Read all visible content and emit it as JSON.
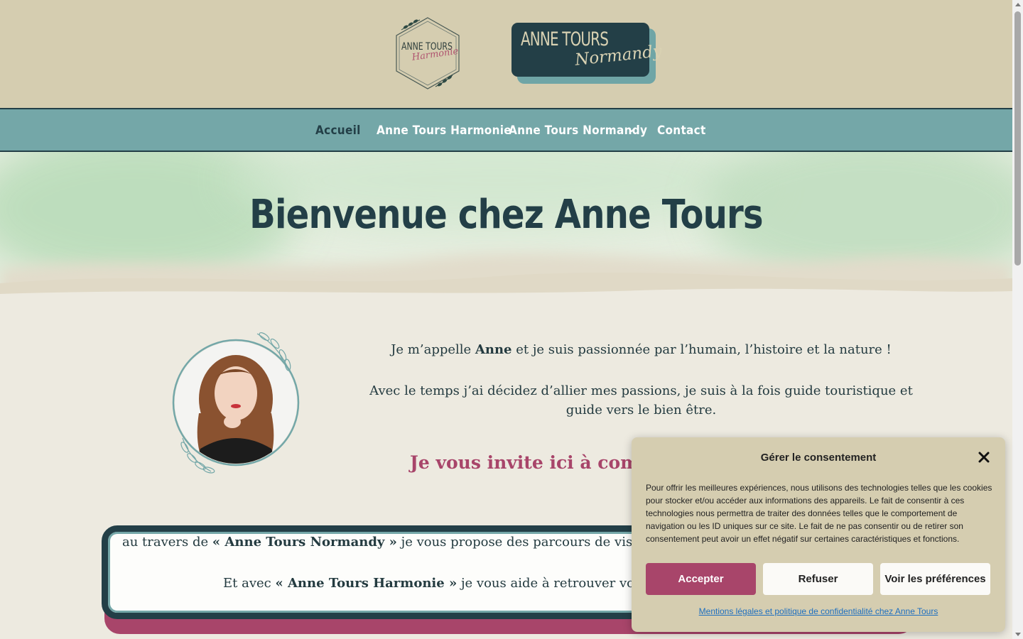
{
  "header": {
    "logo_harmonie": {
      "line1": "ANNE TOURS",
      "line2": "Harmonie"
    },
    "logo_normandy": {
      "line1": "ANNE TOURS",
      "line2": "Normandy"
    }
  },
  "nav": {
    "items": [
      {
        "label": "Accueil",
        "active": true
      },
      {
        "label": "Anne Tours Harmonie",
        "active": false
      },
      {
        "label": "Anne Tours Normandy",
        "active": false,
        "has_dropdown": true
      },
      {
        "label": "Contact",
        "active": false
      }
    ]
  },
  "hero": {
    "title": "Bienvenue chez Anne Tours"
  },
  "intro": {
    "p1_before": "Je m’appelle ",
    "p1_bold": "Anne",
    "p1_after": " et je suis passionnée par l’humain, l’histoire et la nature !",
    "p2": "Avec le temps j’ai décidez d’allier mes passions, je suis à la fois guide touristique et guide vers le bien être.",
    "invite": "Je vous invite ici à commenc"
  },
  "card": {
    "l1_before": "au travers de ",
    "l1_bold": "« Anne Tours Normandy »",
    "l1_after": " je vous propose des parcours de visites g",
    "l2_before": "Et avec ",
    "l2_bold": "« Anne Tours Harmonie »",
    "l2_after": " je vous aide à retrouver votre se"
  },
  "consent": {
    "title": "Gérer le consentement",
    "body": "Pour offrir les meilleures expériences, nous utilisons des technologies telles que les cookies pour stocker et/ou accéder aux informations des appareils. Le fait de consentir à ces technologies nous permettra de traiter des données telles que le comportement de navigation ou les ID uniques sur ce site. Le fait de ne pas consentir ou de retirer son consentement peut avoir un effet négatif sur certaines caractéristiques et fonctions.",
    "accept": "Accepter",
    "refuse": "Refuser",
    "preferences": "Voir les préférences",
    "link": "Mentions légales et politique de confidentialité chez Anne Tours"
  },
  "colors": {
    "header_bg": "#d5cdb0",
    "nav_bg": "#74a7a8",
    "dark_teal": "#233f47",
    "accent_pink": "#a8456a",
    "page_bg": "#edeae0"
  },
  "icons": [
    "chevron-down-icon",
    "close-icon",
    "leaf-wreath-icon"
  ]
}
